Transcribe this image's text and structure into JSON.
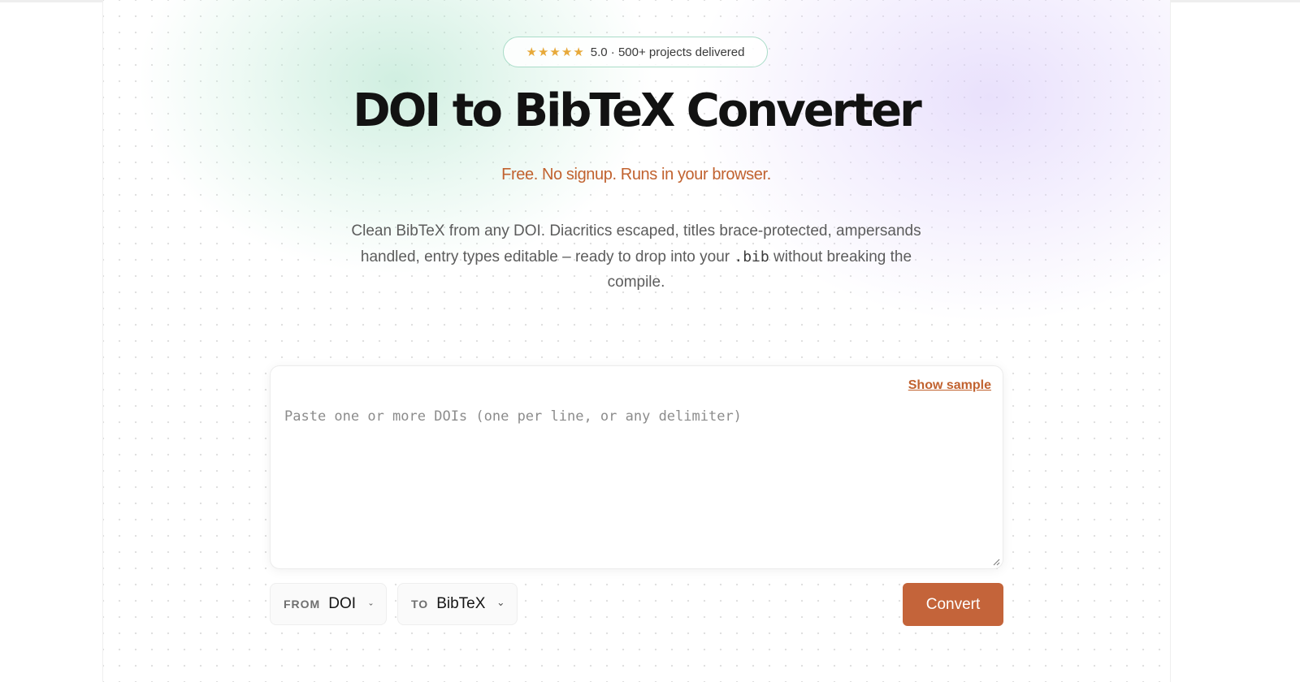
{
  "badge": {
    "star_count": 5,
    "star_glyph": "★",
    "star_color": "#e7a93a",
    "text": "5.0 · 500+ projects delivered"
  },
  "hero": {
    "title": "DOI to BibTeX Converter",
    "tagline": "Free. No signup. Runs in your browser.",
    "description_before": "Clean BibTeX from any DOI. Diacritics escaped, titles brace-protected, ampersands handled, entry types editable – ready to drop into your",
    "description_code": ".bib",
    "description_after": "without breaking the compile."
  },
  "input": {
    "placeholder": "Paste one or more DOIs (one per line, or any delimiter)",
    "value": "",
    "show_sample_label": "Show sample"
  },
  "controls": {
    "from_label": "FROM",
    "from_value": "DOI",
    "to_label": "TO",
    "to_value": "BibTeX",
    "chevron_icon": "chevron-down-icon",
    "convert_label": "Convert"
  },
  "colors": {
    "accent": "#c4643a",
    "tagline": "#c1622f",
    "badge_border": "#a9dcc8"
  }
}
